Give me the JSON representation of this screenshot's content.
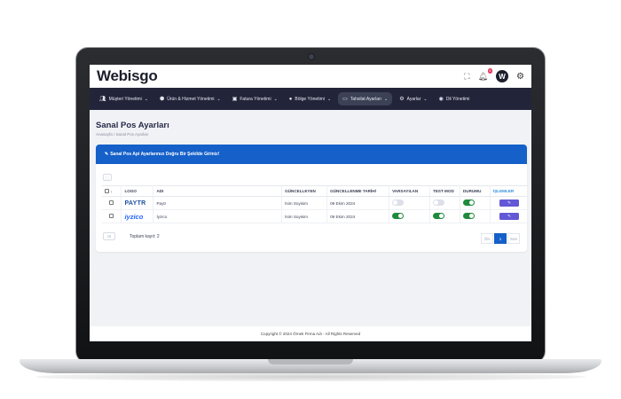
{
  "app": {
    "logo": "Webisgo",
    "avatar_letter": "W",
    "notification_count": "5"
  },
  "nav": [
    {
      "label": "Müşteri Yönetimi",
      "icon": "users-icon",
      "caret": "⌄"
    },
    {
      "label": "Ürün & Hizmet Yönetimi",
      "icon": "cubes-icon",
      "caret": "⌄"
    },
    {
      "label": "Fatura Yönetimi",
      "icon": "money-icon",
      "caret": "⌄"
    },
    {
      "label": "Bölge Yönetimi",
      "icon": "map-pin-icon",
      "caret": "⌄"
    },
    {
      "label": "Tahsilat Ayarları",
      "icon": "credit-card-icon",
      "caret": "⌄"
    },
    {
      "label": "Ayarlar",
      "icon": "cogs-icon",
      "caret": "⌄"
    },
    {
      "label": "Dil Yönetimi",
      "icon": "globe-icon",
      "caret": ""
    }
  ],
  "page": {
    "title": "Sanal Pos Ayarları",
    "breadcrumb": "Anasayfa  /  Sanal Pos Ayarları"
  },
  "alert": {
    "text": "Sanal Pos Api Ayarlarınızı Doğru Bir Şekilde Giriniz!"
  },
  "table": {
    "headers": {
      "logo": "LOGO",
      "name": "ADI",
      "updated_by": "GÜNCELLEYEN",
      "updated_at": "GÜNCELLENME TARİHİ",
      "default": "VARSAYILAN",
      "test": "TEST MOD",
      "status": "DURUMU",
      "actions": "İŞLEMLER"
    },
    "rows": [
      {
        "logo": "PAYTR",
        "name": "Paytr",
        "updated_by": "İsim Soyisim",
        "updated_at": "09 Ekim 2024",
        "default": false,
        "test": false,
        "status": true
      },
      {
        "logo": "iyzico",
        "name": "İyzico",
        "updated_by": "İsim Soyisim",
        "updated_at": "09 Ekim 2024",
        "default": true,
        "test": true,
        "status": true
      }
    ],
    "page_size": "25",
    "total": "Toplam kayıt: 2",
    "pager": {
      "prev": "Ön",
      "current": "1",
      "next": "Son"
    }
  },
  "footer": {
    "text": "Copyright © 2024 Örnek Firma Adı - All Rights Reserved"
  },
  "colors": {
    "nav_bg": "#22253a",
    "alert_bg": "#1560c9",
    "toggle_on": "#1f8a3c",
    "edit_btn": "#6258d6"
  }
}
